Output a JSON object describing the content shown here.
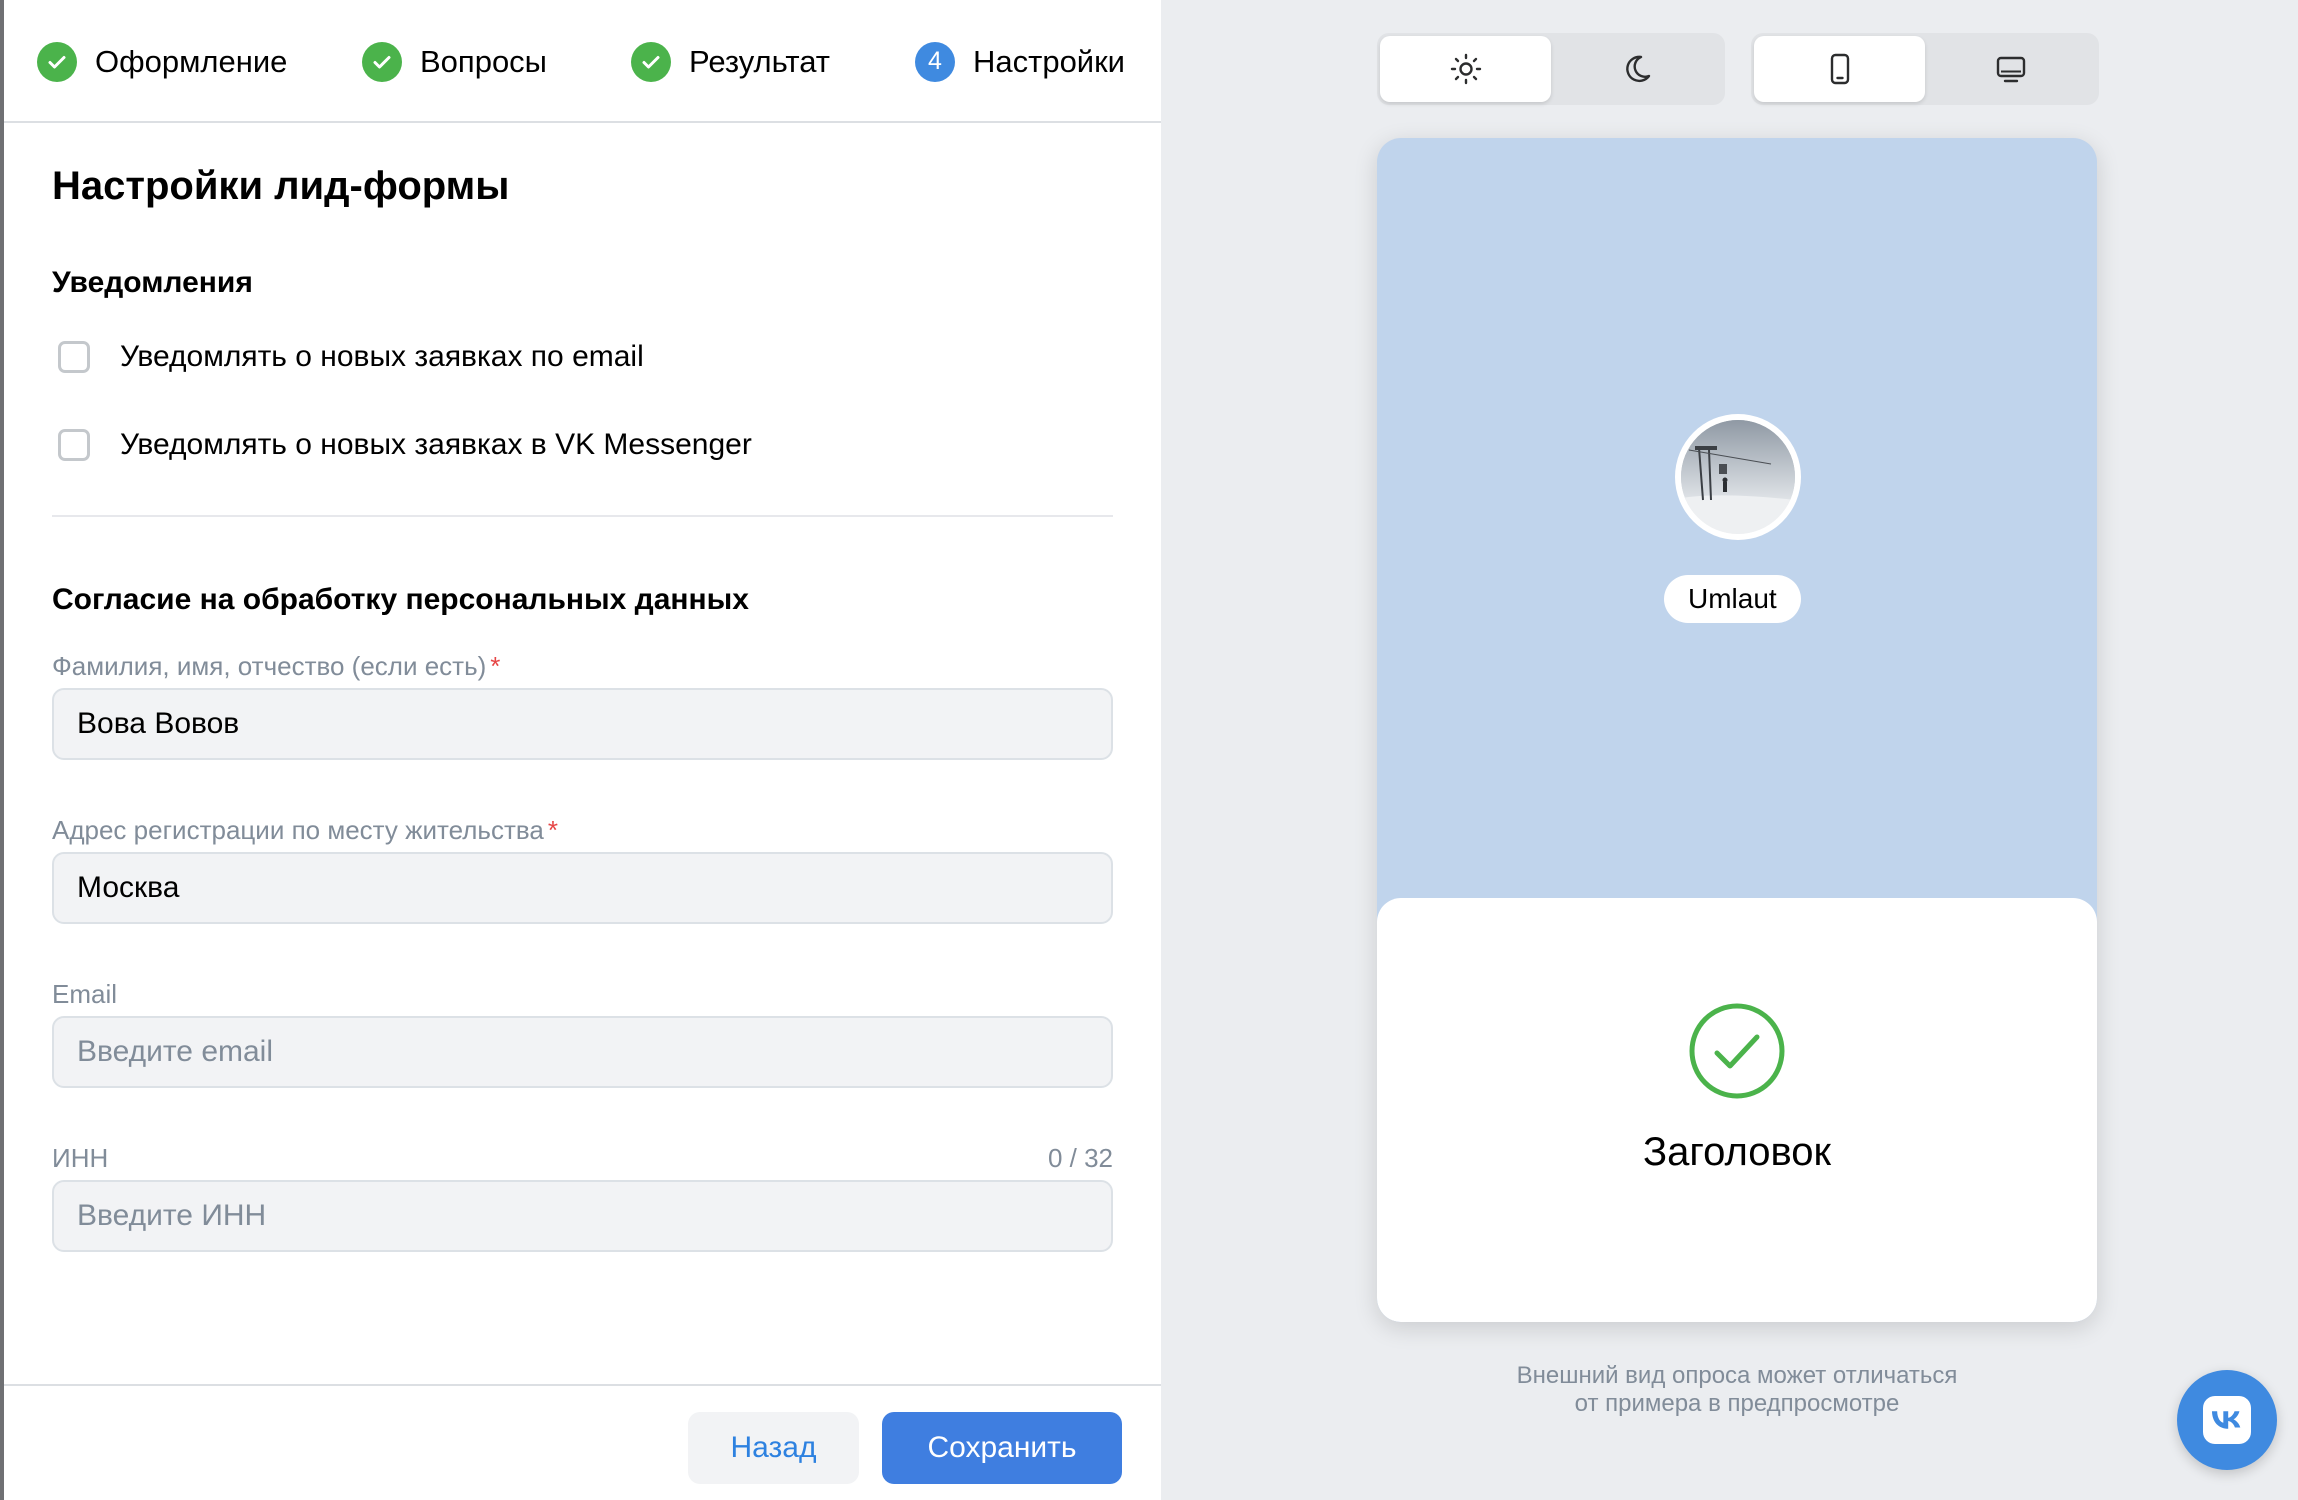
{
  "stepper": {
    "steps": [
      {
        "label": "Оформление",
        "state": "done"
      },
      {
        "label": "Вопросы",
        "state": "done"
      },
      {
        "label": "Результат",
        "state": "done"
      },
      {
        "label": "Настройки",
        "state": "current",
        "number": "4"
      }
    ]
  },
  "form": {
    "title": "Настройки лид-формы",
    "notifications": {
      "title": "Уведомления",
      "email_label": "Уведомлять о новых заявках по email",
      "messenger_label": "Уведомлять о новых заявках в VK Messenger"
    },
    "consent": {
      "title": "Согласие на обработку персональных данных",
      "fields": {
        "fio": {
          "label": "Фамилия, имя, отчество (если есть)",
          "required": "*",
          "value": "Вова Вовов"
        },
        "address": {
          "label": "Адрес регистрации по месту жительства",
          "required": "*",
          "value": "Москва"
        },
        "email": {
          "label": "Email",
          "placeholder": "Введите email"
        },
        "inn": {
          "label": "ИНН",
          "placeholder": "Введите ИНН",
          "counter": "0 / 32"
        }
      }
    }
  },
  "footer": {
    "back_label": "Назад",
    "save_label": "Сохранить"
  },
  "preview": {
    "theme_options": [
      "light",
      "dark"
    ],
    "theme_selected": "light",
    "device_options": [
      "mobile",
      "desktop"
    ],
    "device_selected": "mobile",
    "profile_name": "Umlaut",
    "result_title": "Заголовок",
    "disclaimer_line1": "Внешний вид опроса может отличаться",
    "disclaimer_line2": "от примера в предпросмотре"
  },
  "colors": {
    "accent": "#3f8ae0",
    "success": "#4bb34b",
    "preview_header": "#c0d4ec",
    "required": "#e64646"
  }
}
